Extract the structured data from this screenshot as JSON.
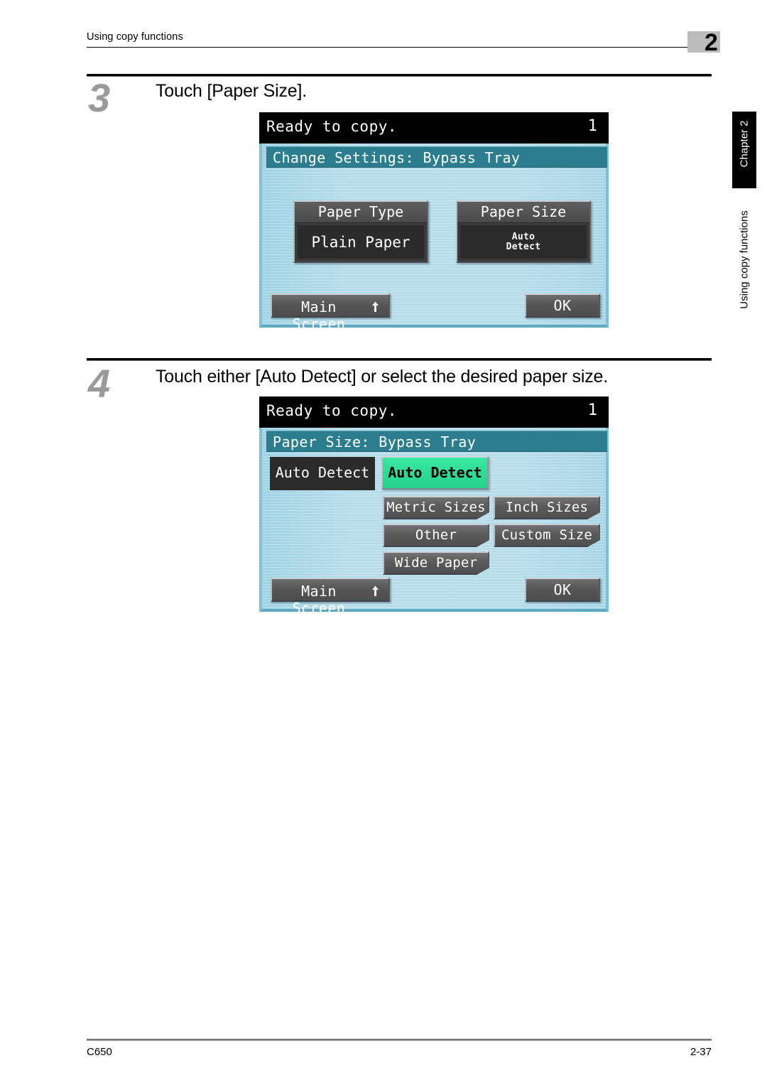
{
  "header": {
    "title": "Using copy functions",
    "chapter_badge": "2"
  },
  "side_tab": {
    "chapter": "Chapter 2",
    "section": "Using copy functions"
  },
  "footer": {
    "model": "C650",
    "page": "2-37"
  },
  "steps": [
    {
      "number": "3",
      "instruction": "Touch [Paper Size].",
      "screen": {
        "status_text": "Ready to copy.",
        "copy_count": "1",
        "title": "Change Settings: Bypass Tray",
        "buttons": [
          {
            "head": "Paper Type",
            "value": "Plain Paper"
          },
          {
            "head": "Paper Size",
            "value": "Auto\nDetect"
          }
        ],
        "main_screen_label": "Main Screen",
        "main_screen_icon": "return-arrow-icon",
        "ok_label": "OK"
      }
    },
    {
      "number": "4",
      "instruction": "Touch either [Auto Detect] or select the desired paper size.",
      "screen": {
        "status_text": "Ready to copy.",
        "copy_count": "1",
        "title": "Paper Size: Bypass Tray",
        "current_value": "Auto Detect",
        "selected_key": "Auto Detect",
        "sub_keys": [
          "Metric Sizes",
          "Inch Sizes",
          "Other",
          "Custom Size",
          "Wide Paper"
        ],
        "main_screen_label": "Main Screen",
        "main_screen_icon": "return-arrow-icon",
        "ok_label": "OK"
      }
    }
  ],
  "colors": {
    "lcd_background": "#b6dcea",
    "lcd_titlebar": "#2c7e8e",
    "selected_key": "#2ee095",
    "status_bar": "#000000",
    "step_number": "#9a9a9a"
  }
}
